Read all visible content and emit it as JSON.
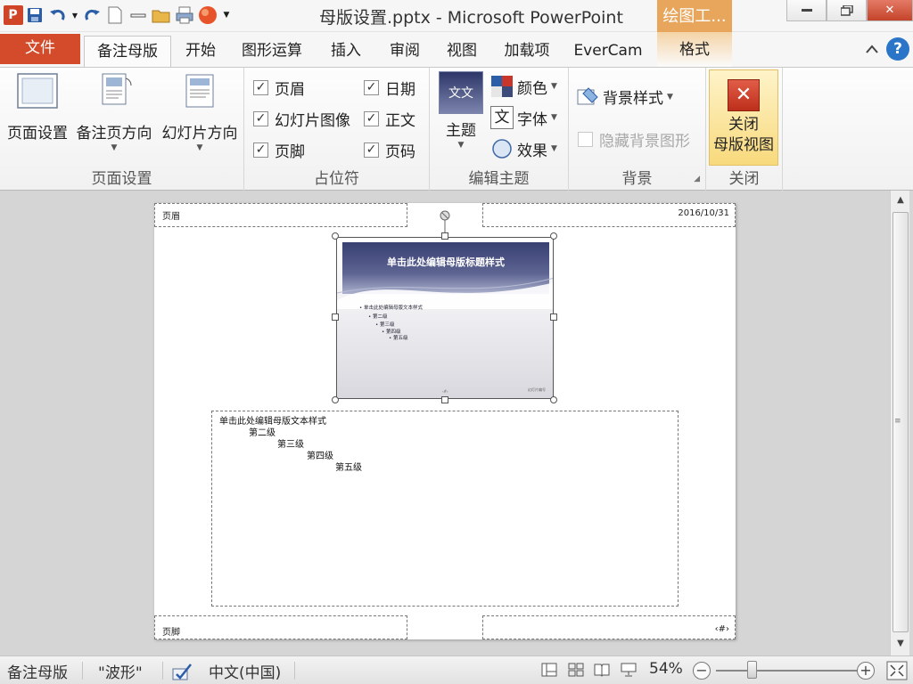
{
  "window": {
    "title": "母版设置.pptx  -  Microsoft PowerPoint",
    "contextual_tab_group": "绘图工...",
    "controls": [
      "minimize-icon",
      "restore-icon",
      "close-icon"
    ]
  },
  "quick_access": {
    "icons": [
      "powerpoint-logo-icon",
      "save-icon",
      "undo-icon",
      "redo-icon",
      "new-document-icon",
      "minus-icon",
      "open-folder-icon",
      "print-icon",
      "record-icon",
      "customize-dropdown-icon"
    ],
    "logo_letter": "P"
  },
  "tabs": [
    {
      "label": "文件",
      "type": "file"
    },
    {
      "label": "备注母版",
      "type": "active"
    },
    {
      "label": "开始"
    },
    {
      "label": "图形运算"
    },
    {
      "label": "插入"
    },
    {
      "label": "审阅"
    },
    {
      "label": "视图"
    },
    {
      "label": "加载项"
    },
    {
      "label": "EverCam"
    },
    {
      "label": "格式",
      "type": "contextual"
    }
  ],
  "ribbon": {
    "page_setup": {
      "label": "页面设置",
      "buttons": [
        "页面设置",
        "备注页方向",
        "幻灯片方向"
      ]
    },
    "placeholders": {
      "label": "占位符",
      "checkboxes": [
        {
          "label": "页眉",
          "checked": true
        },
        {
          "label": "日期",
          "checked": true
        },
        {
          "label": "幻灯片图像",
          "checked": true
        },
        {
          "label": "正文",
          "checked": true
        },
        {
          "label": "页脚",
          "checked": true
        },
        {
          "label": "页码",
          "checked": true
        }
      ]
    },
    "edit_theme": {
      "label": "编辑主题",
      "theme_button": "主题",
      "theme_preview_text": "文文",
      "colors": "颜色",
      "fonts": "字体",
      "font_glyph": "文",
      "effects": "效果"
    },
    "background": {
      "label": "背景",
      "style": "背景样式",
      "hide_graphics": {
        "label": "隐藏背景图形",
        "checked": false,
        "enabled": false
      }
    },
    "close": {
      "label": "关闭",
      "button_line1": "关闭",
      "button_line2": "母版视图",
      "button_glyph": "✕"
    }
  },
  "notes_page": {
    "header": "页眉",
    "date": "2016/10/31",
    "footer": "页脚",
    "page_number": "‹#›",
    "slide": {
      "title": "单击此处编辑母版标题样式",
      "levels": [
        "单击此处编辑母版文本样式",
        "第二级",
        "第三级",
        "第四级",
        "第五级"
      ],
      "footer_number": "‹#›",
      "footer_right": "幻灯片编号"
    },
    "notes_levels": [
      "单击此处编辑母版文本样式",
      "第二级",
      "第三级",
      "第四级",
      "第五级"
    ]
  },
  "status": {
    "view_name": "备注母版",
    "theme_name": "\"波形\"",
    "language": "中文(中国)",
    "zoom": "54%",
    "zoom_value": 54,
    "view_icons": [
      "normal-view-icon",
      "slide-sorter-icon",
      "reading-view-icon",
      "slideshow-icon"
    ]
  },
  "colors": {
    "file_tab": "#d34b2a",
    "contextual": "#e8a65c",
    "close_button": "#f8d97c",
    "slide_title": "#384073"
  }
}
